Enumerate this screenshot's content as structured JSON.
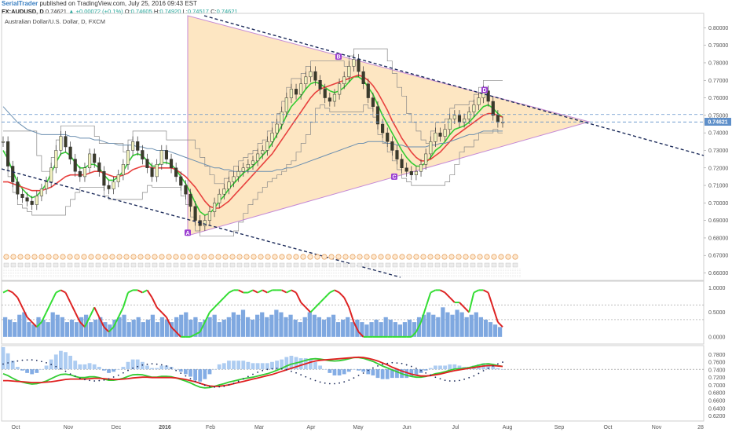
{
  "header": {
    "author": "SerialTrader",
    "published": "published on TradingView.com, July 25, 2016 09:43 EST"
  },
  "ticker": {
    "symbol": "FX:AUDUSD, D",
    "last": "0.74621",
    "change": "▲ +0.00072 (+0.1%)",
    "open_label": "O:",
    "open": "0.74605",
    "high_label": "H:",
    "high": "0.74920",
    "low_label": "L:",
    "low": "0.74517",
    "close_label": "C:",
    "close": "0.74621"
  },
  "chart_data": {
    "type": "line",
    "title": "Australian Dollar/U.S. Dollar, D, FXCM",
    "x_labels": [
      "Oct",
      "Nov",
      "Dec",
      "2016",
      "Feb",
      "Mar",
      "Apr",
      "May",
      "Jun",
      "Jul",
      "Aug",
      "Sep",
      "Oct",
      "Nov",
      "28"
    ],
    "price_axis": {
      "ticks": [
        "0.80000",
        "0.79000",
        "0.78000",
        "0.77000",
        "0.76000",
        "0.75000",
        "0.74000",
        "0.73000",
        "0.72000",
        "0.71000",
        "0.70000",
        "0.69000",
        "0.68000",
        "0.67000",
        "0.66000"
      ],
      "ylim": [
        0.658,
        0.806
      ],
      "current_price_label": "0.74621",
      "reference_level": 0.7505
    },
    "pattern_points": [
      {
        "label": "A",
        "value": 0.683
      },
      {
        "label": "B",
        "value": 0.7835
      },
      {
        "label": "C",
        "value": 0.715
      },
      {
        "label": "D",
        "value": 0.7645
      }
    ],
    "series": [
      {
        "name": "Price",
        "color": "#26a69a",
        "values": [
          0.735,
          0.721,
          0.712,
          0.705,
          0.703,
          0.701,
          0.699,
          0.704,
          0.708,
          0.712,
          0.72,
          0.73,
          0.738,
          0.732,
          0.725,
          0.718,
          0.715,
          0.72,
          0.728,
          0.723,
          0.718,
          0.71,
          0.708,
          0.712,
          0.716,
          0.722,
          0.73,
          0.735,
          0.73,
          0.725,
          0.72,
          0.715,
          0.722,
          0.73,
          0.725,
          0.72,
          0.715,
          0.71,
          0.705,
          0.698,
          0.69,
          0.687,
          0.69,
          0.695,
          0.7,
          0.705,
          0.708,
          0.712,
          0.715,
          0.718,
          0.72,
          0.722,
          0.724,
          0.728,
          0.73,
          0.735,
          0.74,
          0.745,
          0.752,
          0.76,
          0.765,
          0.762,
          0.768,
          0.772,
          0.775,
          0.77,
          0.765,
          0.76,
          0.758,
          0.762,
          0.768,
          0.772,
          0.778,
          0.782,
          0.775,
          0.768,
          0.76,
          0.755,
          0.745,
          0.74,
          0.735,
          0.73,
          0.725,
          0.72,
          0.718,
          0.716,
          0.718,
          0.722,
          0.728,
          0.735,
          0.74,
          0.738,
          0.742,
          0.748,
          0.75,
          0.746,
          0.748,
          0.752,
          0.756,
          0.76,
          0.764,
          0.758,
          0.75,
          0.746,
          0.7462
        ]
      },
      {
        "name": "Fast MA",
        "color": "#33cc33",
        "values": [
          0.73,
          0.725,
          0.718,
          0.712,
          0.708,
          0.705,
          0.703,
          0.704,
          0.707,
          0.711,
          0.717,
          0.723,
          0.728,
          0.729,
          0.727,
          0.723,
          0.72,
          0.72,
          0.722,
          0.722,
          0.72,
          0.716,
          0.713,
          0.713,
          0.715,
          0.718,
          0.723,
          0.727,
          0.728,
          0.727,
          0.724,
          0.721,
          0.721,
          0.723,
          0.723,
          0.722,
          0.719,
          0.715,
          0.711,
          0.706,
          0.7,
          0.695,
          0.693,
          0.694,
          0.697,
          0.701,
          0.704,
          0.708,
          0.711,
          0.714,
          0.717,
          0.719,
          0.721,
          0.724,
          0.727,
          0.73,
          0.734,
          0.739,
          0.744,
          0.75,
          0.755,
          0.758,
          0.761,
          0.765,
          0.768,
          0.769,
          0.768,
          0.766,
          0.764,
          0.763,
          0.764,
          0.766,
          0.769,
          0.772,
          0.772,
          0.77,
          0.766,
          0.762,
          0.756,
          0.75,
          0.745,
          0.74,
          0.735,
          0.73,
          0.726,
          0.723,
          0.721,
          0.721,
          0.723,
          0.726,
          0.73,
          0.732,
          0.735,
          0.739,
          0.742,
          0.743,
          0.744,
          0.746,
          0.749,
          0.752,
          0.755,
          0.756,
          0.754,
          0.751,
          0.749
        ]
      },
      {
        "name": "Slow MA",
        "color": "#e8423f",
        "values": [
          0.712,
          0.712,
          0.711,
          0.71,
          0.709,
          0.708,
          0.707,
          0.707,
          0.707,
          0.708,
          0.709,
          0.711,
          0.713,
          0.715,
          0.716,
          0.716,
          0.716,
          0.716,
          0.717,
          0.718,
          0.718,
          0.717,
          0.716,
          0.715,
          0.715,
          0.716,
          0.717,
          0.719,
          0.72,
          0.721,
          0.721,
          0.72,
          0.72,
          0.72,
          0.72,
          0.72,
          0.719,
          0.717,
          0.715,
          0.712,
          0.709,
          0.705,
          0.701,
          0.698,
          0.697,
          0.697,
          0.699,
          0.701,
          0.704,
          0.707,
          0.71,
          0.713,
          0.716,
          0.719,
          0.722,
          0.725,
          0.728,
          0.732,
          0.736,
          0.74,
          0.744,
          0.748,
          0.752,
          0.756,
          0.76,
          0.763,
          0.765,
          0.766,
          0.767,
          0.768,
          0.769,
          0.77,
          0.771,
          0.772,
          0.773,
          0.772,
          0.77,
          0.767,
          0.763,
          0.758,
          0.753,
          0.747,
          0.742,
          0.737,
          0.733,
          0.729,
          0.726,
          0.724,
          0.724,
          0.725,
          0.727,
          0.729,
          0.732,
          0.735,
          0.738,
          0.74,
          0.742,
          0.744,
          0.746,
          0.748,
          0.75,
          0.751,
          0.751,
          0.75,
          0.749
        ]
      },
      {
        "name": "Long MA",
        "color": "#6b8fb0",
        "values": [
          0.755,
          0.752,
          0.749,
          0.746,
          0.744,
          0.742,
          0.741,
          0.74,
          0.739,
          0.739,
          0.739,
          0.739,
          0.739,
          0.739,
          0.738,
          0.738,
          0.737,
          0.737,
          0.737,
          0.736,
          0.736,
          0.735,
          0.734,
          0.734,
          0.733,
          0.733,
          0.733,
          0.733,
          0.732,
          0.732,
          0.731,
          0.731,
          0.73,
          0.73,
          0.73,
          0.729,
          0.728,
          0.727,
          0.726,
          0.725,
          0.724,
          0.723,
          0.722,
          0.721,
          0.72,
          0.72,
          0.719,
          0.719,
          0.718,
          0.718,
          0.718,
          0.718,
          0.718,
          0.718,
          0.718,
          0.718,
          0.718,
          0.719,
          0.719,
          0.72,
          0.72,
          0.721,
          0.722,
          0.723,
          0.724,
          0.725,
          0.726,
          0.727,
          0.728,
          0.729,
          0.73,
          0.731,
          0.732,
          0.733,
          0.734,
          0.734,
          0.735,
          0.735,
          0.735,
          0.735,
          0.734,
          0.734,
          0.733,
          0.733,
          0.732,
          0.732,
          0.732,
          0.732,
          0.732,
          0.733,
          0.733,
          0.734,
          0.734,
          0.735,
          0.736,
          0.737,
          0.738,
          0.739,
          0.739,
          0.74,
          0.741,
          0.741,
          0.741,
          0.741,
          0.741
        ]
      }
    ],
    "oscillator": {
      "ticks": [
        "1.0000",
        "0.5000",
        "0.0000"
      ],
      "ylim": [
        -0.05,
        1.1
      ],
      "levels": [
        0.65,
        0.35
      ],
      "values": [
        0.9,
        0.95,
        0.9,
        0.8,
        0.6,
        0.4,
        0.3,
        0.2,
        0.3,
        0.5,
        0.7,
        0.9,
        0.95,
        0.9,
        0.7,
        0.5,
        0.3,
        0.2,
        0.4,
        0.6,
        0.4,
        0.2,
        0.1,
        0.2,
        0.4,
        0.6,
        0.9,
        0.95,
        0.95,
        0.9,
        0.95,
        0.8,
        0.6,
        0.5,
        0.4,
        0.2,
        0.1,
        0.0,
        0.0,
        0.0,
        0.05,
        0.1,
        0.3,
        0.5,
        0.6,
        0.7,
        0.8,
        0.9,
        0.95,
        0.95,
        0.9,
        0.9,
        0.95,
        0.9,
        0.95,
        0.9,
        0.95,
        0.95,
        0.95,
        0.9,
        0.95,
        0.9,
        0.7,
        0.6,
        0.5,
        0.6,
        0.7,
        0.8,
        0.9,
        0.95,
        0.9,
        0.8,
        0.6,
        0.3,
        0.1,
        0.0,
        0.0,
        0.0,
        0.0,
        0.0,
        0.0,
        0.0,
        0.0,
        0.0,
        0.0,
        0.0,
        0.1,
        0.3,
        0.6,
        0.9,
        0.95,
        0.95,
        0.9,
        0.8,
        0.7,
        0.7,
        0.6,
        0.5,
        0.9,
        0.95,
        0.95,
        0.9,
        0.6,
        0.3,
        0.2
      ],
      "histogram": [
        0.4,
        0.35,
        0.3,
        0.45,
        0.5,
        0.3,
        0.25,
        0.4,
        0.35,
        0.3,
        0.5,
        0.45,
        0.4,
        0.3,
        0.35,
        0.3,
        0.4,
        0.45,
        0.3,
        0.35,
        0.4,
        0.3,
        0.25,
        0.35,
        0.4,
        0.45,
        0.3,
        0.35,
        0.4,
        0.3,
        0.35,
        0.45,
        0.3,
        0.4,
        0.35,
        0.3,
        0.4,
        0.45,
        0.5,
        0.35,
        0.4,
        0.3,
        0.35,
        0.4,
        0.45,
        0.3,
        0.35,
        0.4,
        0.5,
        0.45,
        0.55,
        0.4,
        0.35,
        0.45,
        0.5,
        0.4,
        0.45,
        0.55,
        0.5,
        0.4,
        0.45,
        0.35,
        0.3,
        0.4,
        0.5,
        0.45,
        0.4,
        0.35,
        0.4,
        0.45,
        0.3,
        0.35,
        0.4,
        0.3,
        0.35,
        0.3,
        0.25,
        0.3,
        0.35,
        0.3,
        0.4,
        0.35,
        0.3,
        0.25,
        0.3,
        0.35,
        0.3,
        0.4,
        0.45,
        0.5,
        0.45,
        0.4,
        0.6,
        0.5,
        0.45,
        0.55,
        0.5,
        0.4,
        0.45,
        0.5,
        0.4,
        0.35,
        0.3,
        0.25,
        0.2
      ]
    },
    "macd_panel": {
      "ticks": [
        "0.7800",
        "0.7600",
        "0.7400",
        "0.7200",
        "0.7000",
        "0.6800",
        "0.6600",
        "0.6400",
        "0.6200"
      ],
      "ylim": [
        0.615,
        0.795
      ],
      "reference_level": 0.7415
    }
  }
}
